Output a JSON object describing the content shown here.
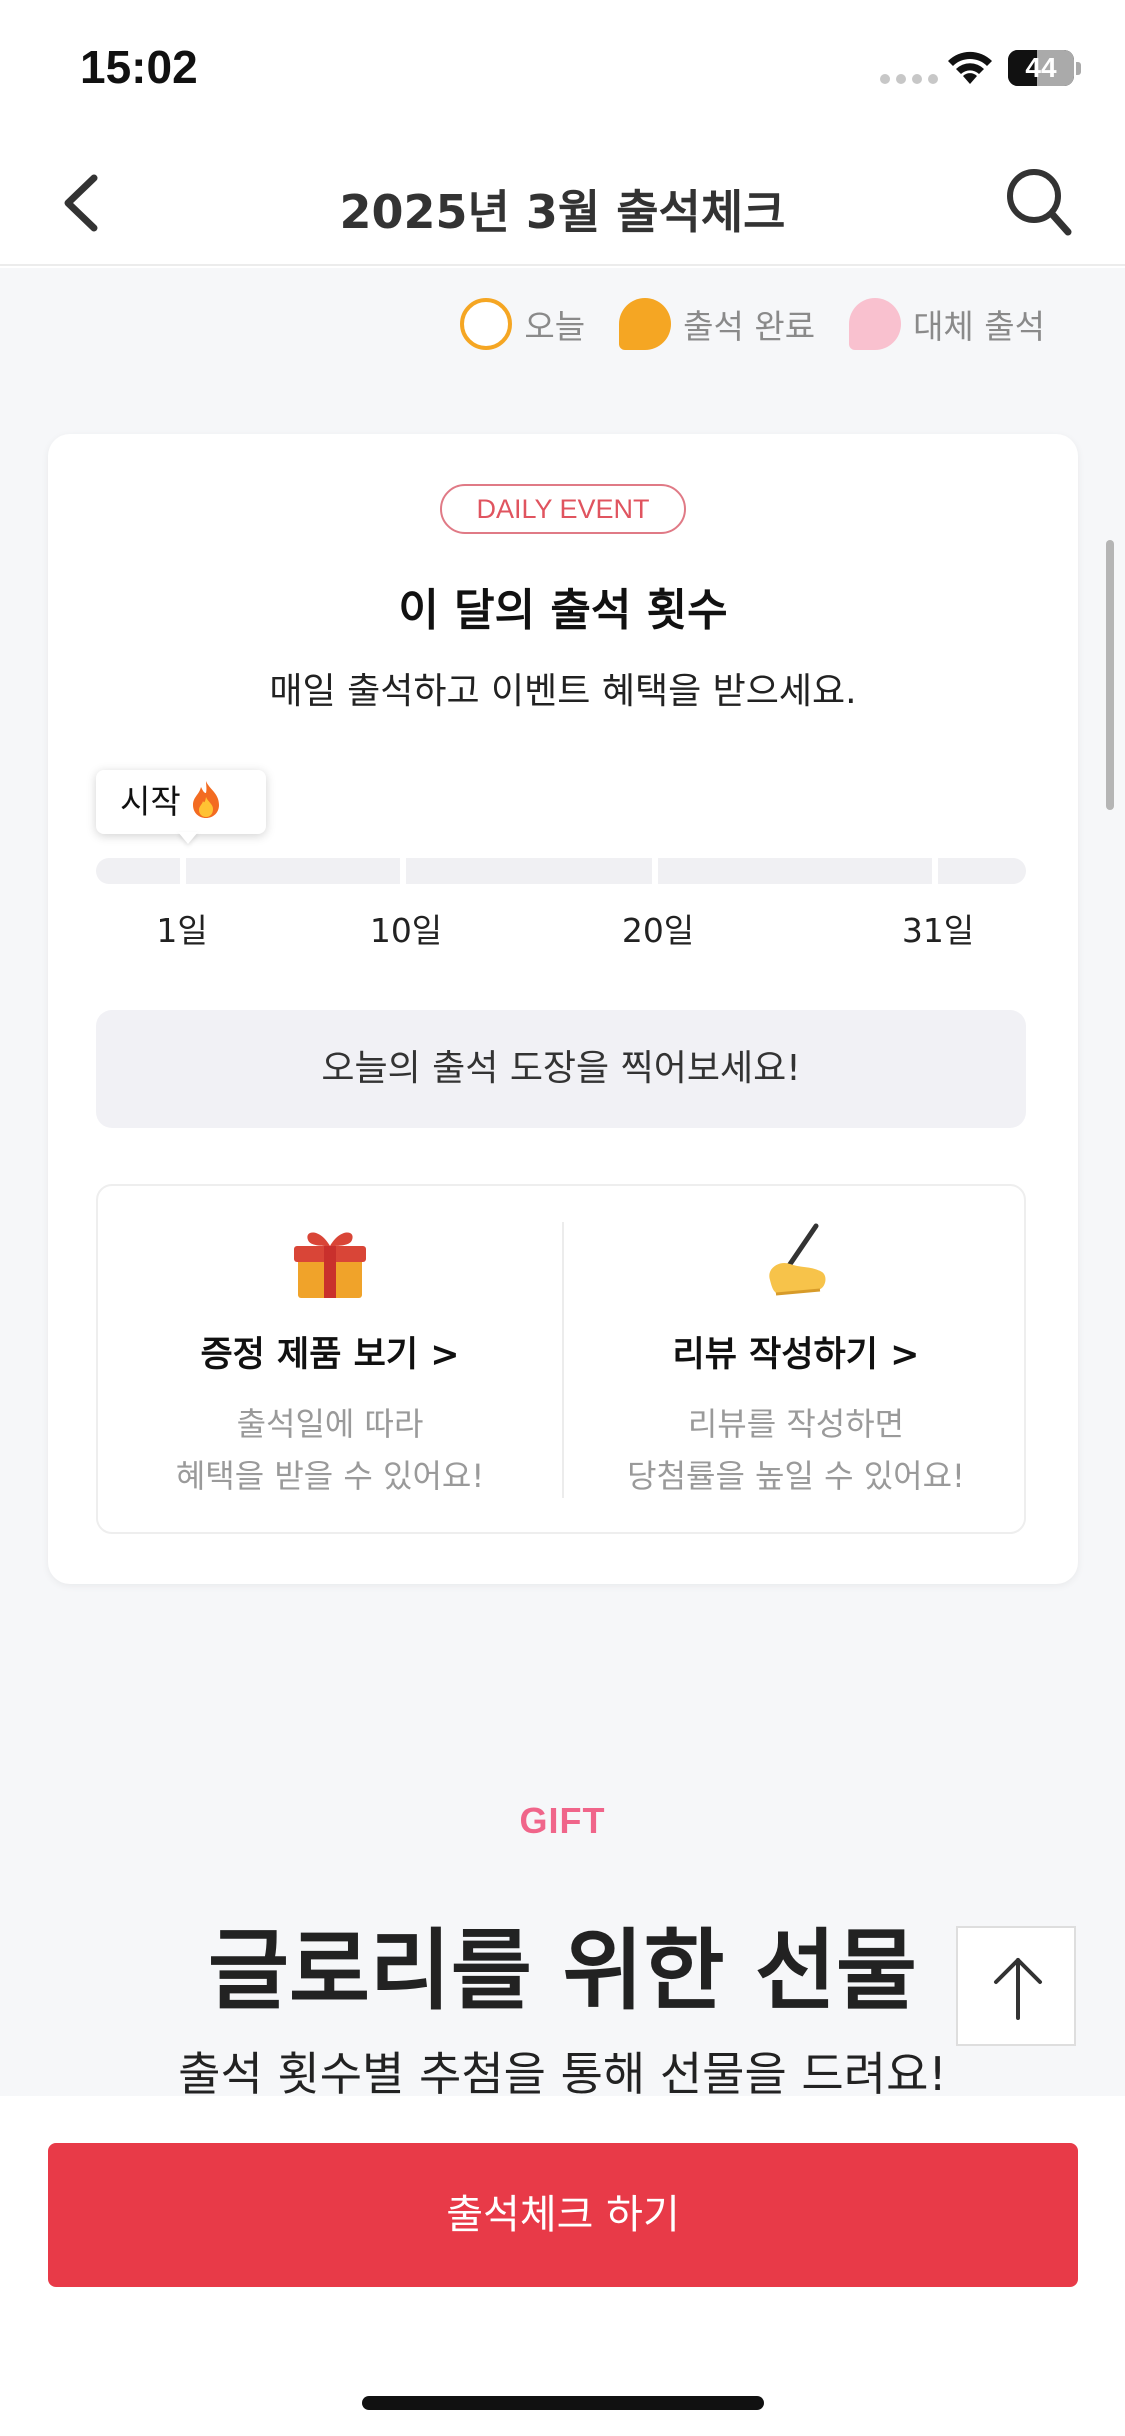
{
  "status_bar": {
    "time": "15:02",
    "battery": "44",
    "battery_level": 0.44
  },
  "nav": {
    "title": "2025년 3월 출석체크",
    "back_icon": "chevron-left-icon",
    "search_icon": "search-icon"
  },
  "legend": {
    "today": "오늘",
    "done": "출석 완료",
    "substitute": "대체 출석",
    "colors": {
      "today": "#f5a623",
      "done": "#f5a623",
      "substitute": "#f9c1cf"
    }
  },
  "card": {
    "badge": "DAILY EVENT",
    "title": "이 달의 출석 횟수",
    "subtitle": "매일 출석하고 이벤트 혜택을 받으세요.",
    "tooltip": "시작",
    "tooltip_icon": "fire-icon",
    "progress": {
      "attended_days": 0,
      "total_days": 31
    },
    "ticks": [
      "1일",
      "10일",
      "20일",
      "31일"
    ],
    "stamp_prompt": "오늘의 출석 도장을 찍어보세요!",
    "links": [
      {
        "icon": "gift-icon",
        "title": "증정 제품 보기 >",
        "desc_line1": "출석일에 따라",
        "desc_line2": "혜택을 받을 수 있어요!"
      },
      {
        "icon": "writing-hand-icon",
        "title": "리뷰 작성하기 >",
        "desc_line1": "리뷰를 작성하면",
        "desc_line2": "당첨률을 높일 수 있어요!"
      }
    ]
  },
  "gift": {
    "label": "GIFT",
    "title": "글로리를 위한 선물",
    "subtitle": "출석 횟수별 추첨을 통해 선물을 드려요!"
  },
  "scroll_top_icon": "arrow-up-icon",
  "cta": {
    "label": "출석체크 하기",
    "color": "#e83a48"
  }
}
